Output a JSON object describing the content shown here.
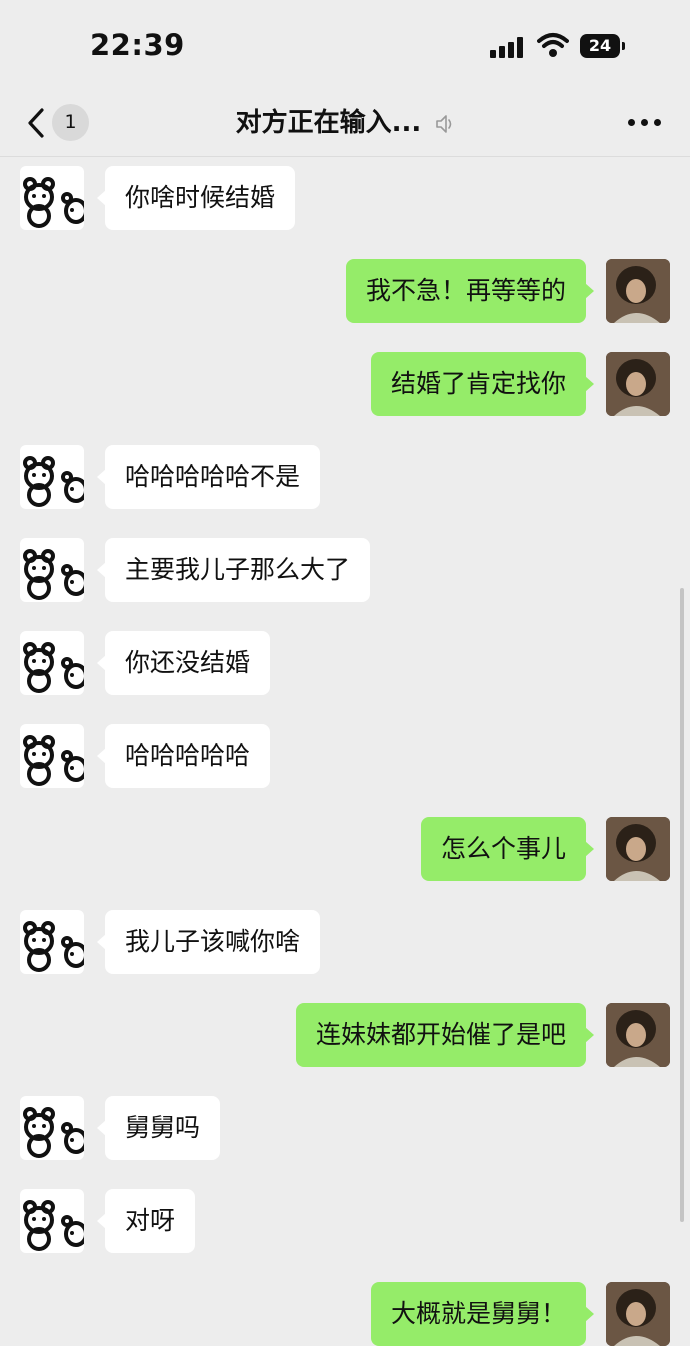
{
  "status_bar": {
    "time": "22:39",
    "battery": "24",
    "icons": [
      "signal-icon",
      "wifi-icon",
      "battery-icon"
    ]
  },
  "nav": {
    "unread_count": "1",
    "title": "对方正在输入...",
    "icons": [
      "back-icon",
      "mute-icon",
      "more-icon"
    ]
  },
  "colors": {
    "background": "#ededed",
    "incoming_bubble": "#ffffff",
    "outgoing_bubble": "#95ec69"
  },
  "messages": [
    {
      "side": "left",
      "text": "你啥时候结婚"
    },
    {
      "side": "right",
      "text": "我不急！再等等的"
    },
    {
      "side": "right",
      "text": "结婚了肯定找你"
    },
    {
      "side": "left",
      "text": "哈哈哈哈哈不是"
    },
    {
      "side": "left",
      "text": "主要我儿子那么大了"
    },
    {
      "side": "left",
      "text": "你还没结婚"
    },
    {
      "side": "left",
      "text": "哈哈哈哈哈"
    },
    {
      "side": "right",
      "text": "怎么个事儿"
    },
    {
      "side": "left",
      "text": "我儿子该喊你啥"
    },
    {
      "side": "right",
      "text": "连妹妹都开始催了是吧"
    },
    {
      "side": "left",
      "text": "舅舅吗"
    },
    {
      "side": "left",
      "text": "对呀"
    },
    {
      "side": "right",
      "text": "大概就是舅舅！"
    }
  ]
}
